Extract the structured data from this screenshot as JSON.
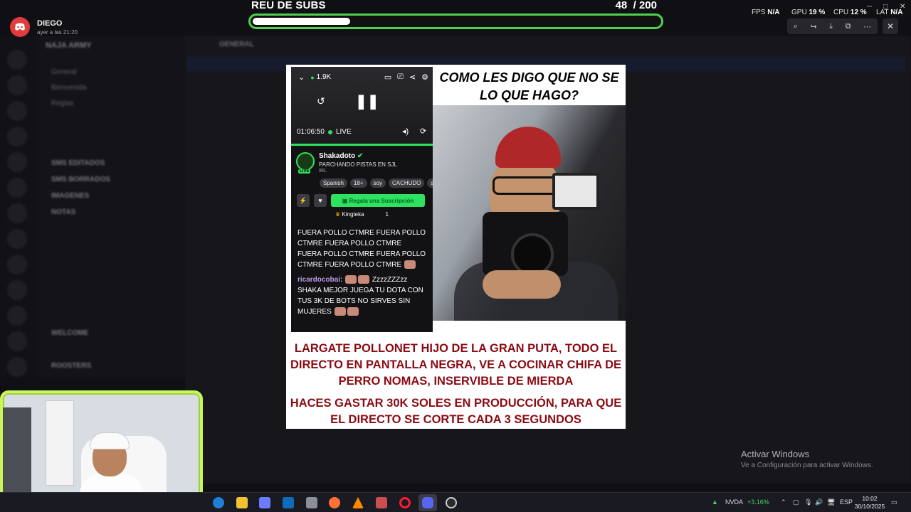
{
  "notification": {
    "user": "DIEGO",
    "time": "ayer a las 21:20"
  },
  "sub_goal": {
    "title": "REU DE SUBS",
    "count": "48",
    "separator": "/",
    "target": "200",
    "progress_fraction": 0.24
  },
  "perf": {
    "fps_label": "FPS",
    "fps_value": "N/A",
    "gpu_label": "GPU",
    "gpu_value": "19 %",
    "cpu_label": "CPU",
    "cpu_value": "12 %",
    "lat_label": "LAT",
    "lat_value": "N/A"
  },
  "background": {
    "server_name": "NAJA ARMY",
    "channel_header": "GENERAL",
    "channels": [
      "General",
      "Bienvenida",
      "Reglas",
      "SMS EDITADOS",
      "SMS BORRADOS",
      "IMAGENES",
      "NOTAS",
      "WELCOME",
      "ROOSTERS"
    ]
  },
  "stream_app": {
    "viewers": "1.9K",
    "time": "01:06:50",
    "live": "LIVE",
    "streamer": "Shakadoto",
    "stream_title": "PARCHANDO PISTAS EN SJL",
    "category": "IRL",
    "tags": [
      "Spanish",
      "18+",
      "soy",
      "CACHUDO",
      "si"
    ],
    "gift_button": "Regala una Suscripción",
    "pinned_user": "Kingteka",
    "pinned_count": "1",
    "chat": [
      {
        "user": "",
        "text": "FUERA POLLO CTMRE FUERA POLLO CTMRE FUERA POLLO CTMRE FUERA POLLO CTMRE FUERA POLLO CTMRE FUERA POLLO CTMRE"
      },
      {
        "user": "ricardocobai:",
        "text": "ZzzzZZZzz SHAKA MEJOR JUEGA TU DOTA CON TUS 3K DE BOTS NO SIRVES SIN MUJERES"
      }
    ]
  },
  "meme": {
    "caption_top": "COMO LES DIGO QUE NO SE LO QUE HAGO?",
    "caption_bottom_1": "LARGATE POLLONET HIJO DE LA GRAN PUTA, TODO EL DIRECTO EN PANTALLA NEGRA, VE A COCINAR CHIFA DE PERRO NOMAS, INSERVIBLE DE MIERDA",
    "caption_bottom_2": "HACES GASTAR 30K SOLES EN PRODUCCIÓN, PARA QUE EL DIRECTO SE CORTE CADA 3 SEGUNDOS"
  },
  "windows_activation": {
    "title": "Activar Windows",
    "subtitle": "Ve a Configuración para activar Windows."
  },
  "taskbar": {
    "stock_symbol": "NVDA",
    "stock_change": "+3.16%",
    "language": "ESP",
    "time": "10:02",
    "date": "30/10/2025"
  },
  "colors": {
    "goal_green": "#4fcf53",
    "live_green": "#2ee15e",
    "caption_red": "#8b0a12",
    "webcam_border": "#caf55a"
  }
}
